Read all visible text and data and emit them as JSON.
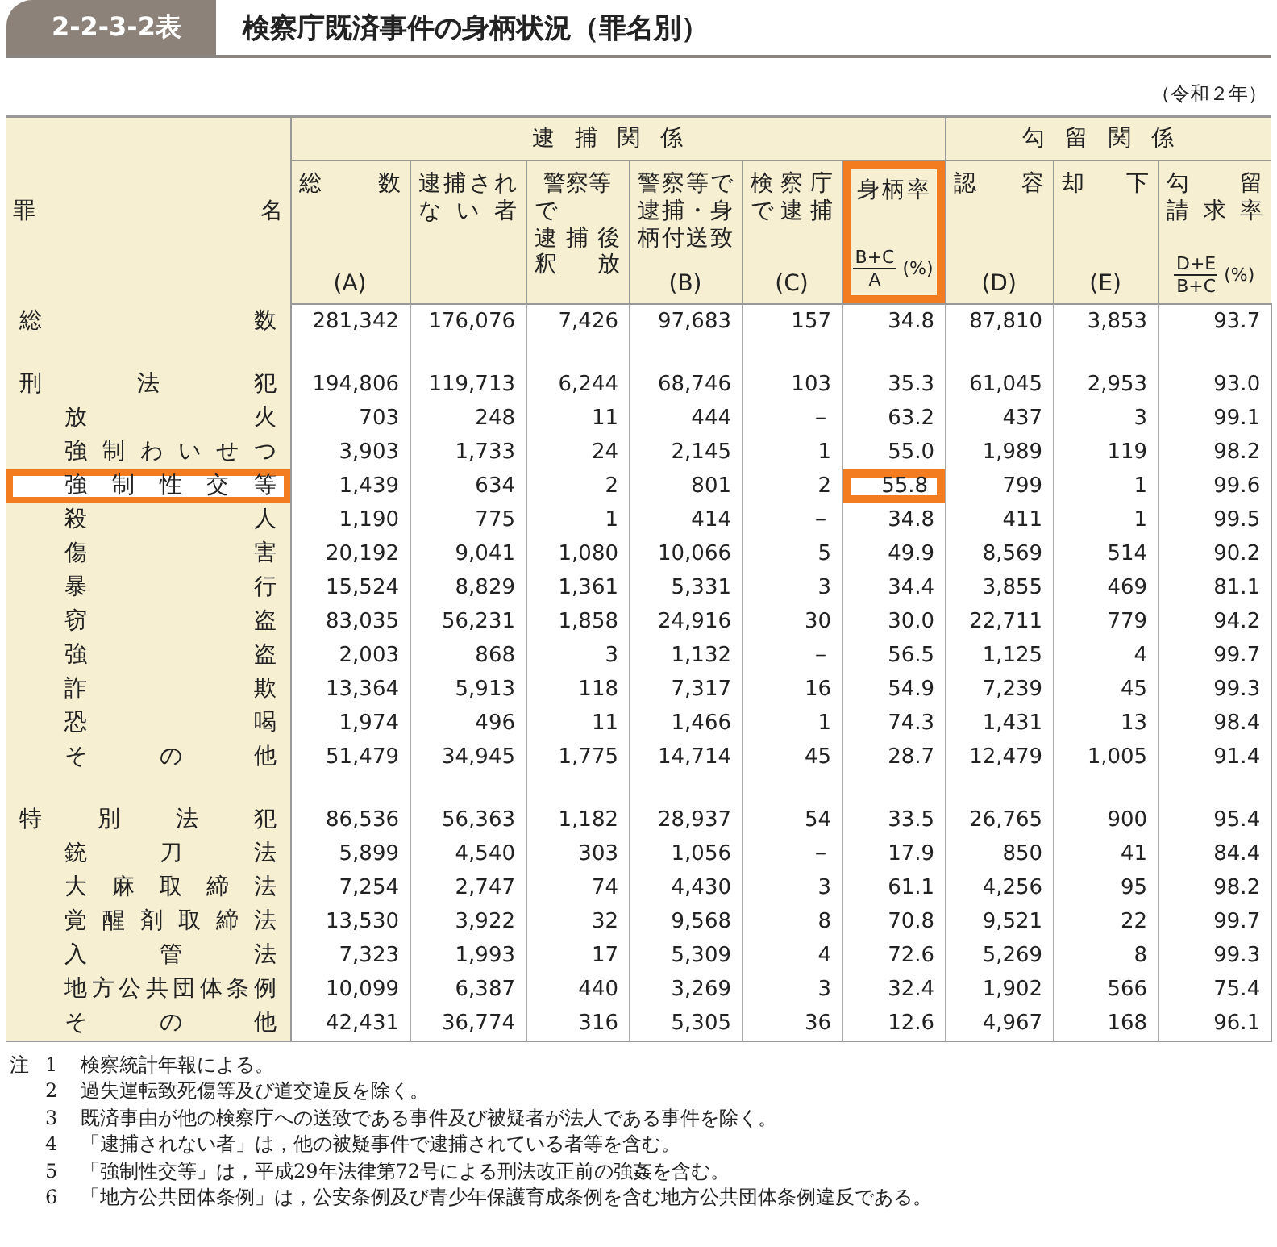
{
  "title": {
    "number": "2-2-3-2表",
    "text": "検察庁既済事件の身柄状況（罪名別）"
  },
  "year_note": "（令和２年）",
  "table": {
    "corner": "罪名",
    "groups": [
      {
        "label": "逮捕関係",
        "columns": [
          {
            "lines": [
              "総数"
            ],
            "sub": "(A)",
            "highlighted": false
          },
          {
            "lines": [
              "逮捕され",
              "ない者"
            ],
            "highlighted": false
          },
          {
            "lines": [
              "警察等で",
              "逮捕後",
              "釈放"
            ],
            "highlighted": false
          },
          {
            "lines": [
              "警察等で",
              "逮捕・身",
              "柄付送致"
            ],
            "sub": "(B)",
            "highlighted": false
          },
          {
            "lines": [
              "検察庁",
              "で逮捕"
            ],
            "sub": "(C)",
            "highlighted": false
          },
          {
            "lines": [
              "身柄率"
            ],
            "fraction": {
              "numerator": "B+C",
              "denominator": "A"
            },
            "unit": "(%)",
            "highlighted": true
          }
        ]
      },
      {
        "label": "勾留関係",
        "columns": [
          {
            "lines": [
              "認容"
            ],
            "sub": "(D)",
            "highlighted": false
          },
          {
            "lines": [
              "却下"
            ],
            "sub": "(E)",
            "highlighted": false
          },
          {
            "lines": [
              "勾留",
              "請求率"
            ],
            "fraction": {
              "numerator": "D+E",
              "denominator": "B+C"
            },
            "unit": "(%)",
            "highlighted": false
          }
        ]
      }
    ],
    "rows": [
      {
        "kind": "total",
        "name": "総数",
        "highlighted": false,
        "values": [
          "281,342",
          "176,076",
          "7,426",
          "97,683",
          "157",
          "34.8",
          "87,810",
          "3,853",
          "93.7"
        ]
      },
      {
        "kind": "category",
        "name": "刑法犯",
        "highlighted": false,
        "values": [
          "194,806",
          "119,713",
          "6,244",
          "68,746",
          "103",
          "35.3",
          "61,045",
          "2,953",
          "93.0"
        ]
      },
      {
        "kind": "item",
        "name": "放火",
        "highlighted": false,
        "values": [
          "703",
          "248",
          "11",
          "444",
          "－",
          "63.2",
          "437",
          "3",
          "99.1"
        ]
      },
      {
        "kind": "item",
        "name": "強制わいせつ",
        "highlighted": false,
        "values": [
          "3,903",
          "1,733",
          "24",
          "2,145",
          "1",
          "55.0",
          "1,989",
          "119",
          "98.2"
        ]
      },
      {
        "kind": "item",
        "name": "強制性交等",
        "highlighted": true,
        "values": [
          "1,439",
          "634",
          "2",
          "801",
          "2",
          "55.8",
          "799",
          "1",
          "99.6"
        ]
      },
      {
        "kind": "item",
        "name": "殺人",
        "highlighted": false,
        "values": [
          "1,190",
          "775",
          "1",
          "414",
          "－",
          "34.8",
          "411",
          "1",
          "99.5"
        ]
      },
      {
        "kind": "item",
        "name": "傷害",
        "highlighted": false,
        "values": [
          "20,192",
          "9,041",
          "1,080",
          "10,066",
          "5",
          "49.9",
          "8,569",
          "514",
          "90.2"
        ]
      },
      {
        "kind": "item",
        "name": "暴行",
        "highlighted": false,
        "values": [
          "15,524",
          "8,829",
          "1,361",
          "5,331",
          "3",
          "34.4",
          "3,855",
          "469",
          "81.1"
        ]
      },
      {
        "kind": "item",
        "name": "窃盗",
        "highlighted": false,
        "values": [
          "83,035",
          "56,231",
          "1,858",
          "24,916",
          "30",
          "30.0",
          "22,711",
          "779",
          "94.2"
        ]
      },
      {
        "kind": "item",
        "name": "強盗",
        "highlighted": false,
        "values": [
          "2,003",
          "868",
          "3",
          "1,132",
          "－",
          "56.5",
          "1,125",
          "4",
          "99.7"
        ]
      },
      {
        "kind": "item",
        "name": "詐欺",
        "highlighted": false,
        "values": [
          "13,364",
          "5,913",
          "118",
          "7,317",
          "16",
          "54.9",
          "7,239",
          "45",
          "99.3"
        ]
      },
      {
        "kind": "item",
        "name": "恐喝",
        "highlighted": false,
        "values": [
          "1,974",
          "496",
          "11",
          "1,466",
          "1",
          "74.3",
          "1,431",
          "13",
          "98.4"
        ]
      },
      {
        "kind": "item",
        "name": "その他",
        "highlighted": false,
        "values": [
          "51,479",
          "34,945",
          "1,775",
          "14,714",
          "45",
          "28.7",
          "12,479",
          "1,005",
          "91.4"
        ]
      },
      {
        "kind": "category",
        "name": "特別法犯",
        "highlighted": false,
        "values": [
          "86,536",
          "56,363",
          "1,182",
          "28,937",
          "54",
          "33.5",
          "26,765",
          "900",
          "95.4"
        ]
      },
      {
        "kind": "item",
        "name": "銃刀法",
        "highlighted": false,
        "values": [
          "5,899",
          "4,540",
          "303",
          "1,056",
          "－",
          "17.9",
          "850",
          "41",
          "84.4"
        ]
      },
      {
        "kind": "item",
        "name": "大麻取締法",
        "highlighted": false,
        "values": [
          "7,254",
          "2,747",
          "74",
          "4,430",
          "3",
          "61.1",
          "4,256",
          "95",
          "98.2"
        ]
      },
      {
        "kind": "item",
        "name": "覚醒剤取締法",
        "highlighted": false,
        "values": [
          "13,530",
          "3,922",
          "32",
          "9,568",
          "8",
          "70.8",
          "9,521",
          "22",
          "99.7"
        ]
      },
      {
        "kind": "item",
        "name": "入管法",
        "highlighted": false,
        "values": [
          "7,323",
          "1,993",
          "17",
          "5,309",
          "4",
          "72.6",
          "5,269",
          "8",
          "99.3"
        ]
      },
      {
        "kind": "item",
        "name": "地方公共団体条例",
        "highlighted": false,
        "values": [
          "10,099",
          "6,387",
          "440",
          "3,269",
          "3",
          "32.4",
          "1,902",
          "566",
          "75.4"
        ]
      },
      {
        "kind": "item",
        "name": "その他",
        "highlighted": false,
        "values": [
          "42,431",
          "36,774",
          "316",
          "5,305",
          "36",
          "12.6",
          "4,967",
          "168",
          "96.1"
        ]
      }
    ]
  },
  "notes": {
    "label": "注",
    "items": [
      {
        "mark": "1",
        "text": "検察統計年報による。"
      },
      {
        "mark": "2",
        "text": "過失運転致死傷等及び道交違反を除く。"
      },
      {
        "mark": "3",
        "text": "既済事由が他の検察庁への送致である事件及び被疑者が法人である事件を除く。"
      },
      {
        "mark": "4",
        "text": "「逮捕されない者」は，他の被疑事件で逮捕されている者等を含む。"
      },
      {
        "mark": "5",
        "text": "「強制性交等」は，平成29年法律第72号による刑法改正前の強姦を含む。"
      },
      {
        "mark": "6",
        "text": "「地方公共団体条例」は，公安条例及び青少年保護育成条例を含む地方公共団体条例違反である。"
      }
    ]
  }
}
